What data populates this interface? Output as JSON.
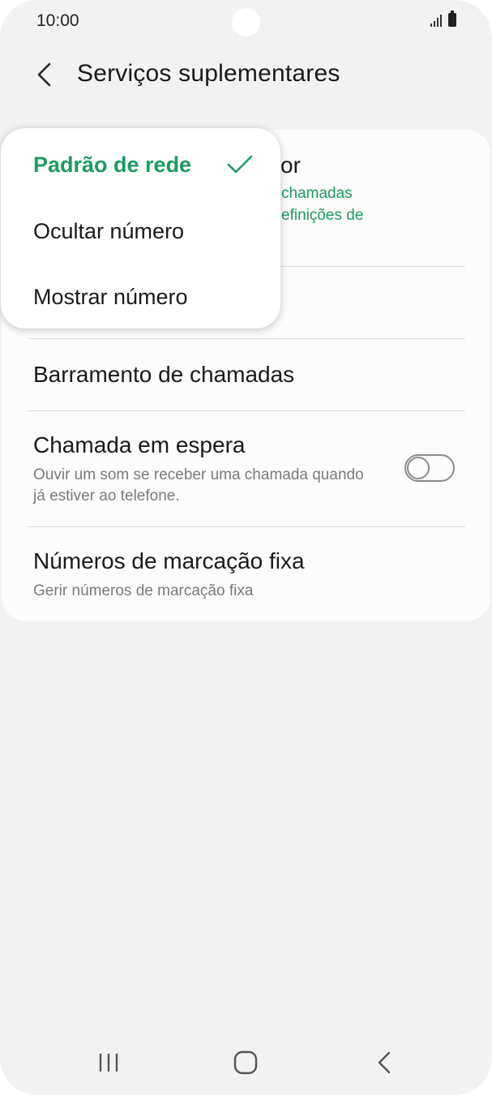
{
  "status_bar": {
    "time": "10:00",
    "icons": [
      "signal-icon",
      "battery-icon"
    ]
  },
  "header": {
    "title": "Serviços suplementares",
    "back_icon": "chevron-left-icon"
  },
  "settings": {
    "caller_id": {
      "title_visible": "or",
      "subtitle_line1_visible": "chamadas",
      "subtitle_line2_visible": "efinições de"
    },
    "call_barring": {
      "title": "Barramento de chamadas"
    },
    "call_waiting": {
      "title": "Chamada em espera",
      "subtitle": "Ouvir um som se receber uma chamada quando já estiver ao telefone.",
      "enabled": false
    },
    "fixed_dialing": {
      "title": "Números de marcação fixa",
      "subtitle": "Gerir números de marcação fixa"
    }
  },
  "popup": {
    "options": [
      {
        "label": "Padrão de rede",
        "selected": true
      },
      {
        "label": "Ocultar número",
        "selected": false
      },
      {
        "label": "Mostrar número",
        "selected": false
      }
    ]
  },
  "nav_bar": {
    "icons": [
      "recent-apps-icon",
      "home-icon",
      "back-icon"
    ]
  },
  "colors": {
    "accent": "#1c9b63",
    "background": "#f2f2f2",
    "card": "#fcfcfc"
  }
}
